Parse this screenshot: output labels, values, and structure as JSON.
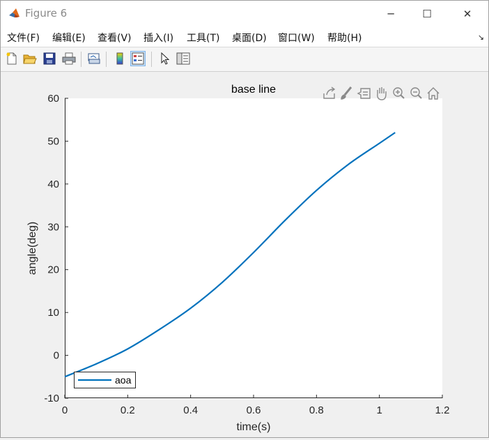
{
  "window": {
    "title": "Figure 6",
    "controls": {
      "minimize": "─",
      "maximize": "☐",
      "close": "✕"
    }
  },
  "menu": {
    "items": [
      "文件(F)",
      "编辑(E)",
      "查看(V)",
      "插入(I)",
      "工具(T)",
      "桌面(D)",
      "窗口(W)",
      "帮助(H)"
    ],
    "overflow": "↘"
  },
  "toolbar": {
    "buttons": [
      "new-figure",
      "open-file",
      "save",
      "print",
      "link-plot",
      "insert-colorbar",
      "insert-legend",
      "edit-plot",
      "property-inspector"
    ]
  },
  "axes_toolbar": {
    "buttons": [
      "export-icon",
      "brush-icon",
      "data-tips-icon",
      "pan-icon",
      "zoom-in-icon",
      "zoom-out-icon",
      "home-icon"
    ]
  },
  "colors": {
    "line": "#0072BD",
    "axes_bg": "#ffffff",
    "figure_bg": "#f0f0f0"
  },
  "chart_data": {
    "type": "line",
    "title": "base line",
    "xlabel": "time(s)",
    "ylabel": "angle(deg)",
    "xlim": [
      0,
      1.2
    ],
    "ylim": [
      -10,
      60
    ],
    "xticks": [
      0,
      0.2,
      0.4,
      0.6,
      0.8,
      1,
      1.2
    ],
    "xtick_labels": [
      "0",
      "0.2",
      "0.4",
      "0.6",
      "0.8",
      "1",
      "1.2"
    ],
    "yticks": [
      -10,
      0,
      10,
      20,
      30,
      40,
      50,
      60
    ],
    "ytick_labels": [
      "-10",
      "0",
      "10",
      "20",
      "30",
      "40",
      "50",
      "60"
    ],
    "grid": false,
    "legend": {
      "location": "bottom-left",
      "entries": [
        "aoa"
      ]
    },
    "series": [
      {
        "name": "aoa",
        "x": [
          0,
          0.1,
          0.2,
          0.3,
          0.4,
          0.5,
          0.6,
          0.7,
          0.8,
          0.9,
          1.0,
          1.05
        ],
        "y": [
          -5,
          -2,
          1.5,
          6,
          11,
          17,
          24,
          31.5,
          38.5,
          44.5,
          49.5,
          52
        ]
      }
    ]
  }
}
